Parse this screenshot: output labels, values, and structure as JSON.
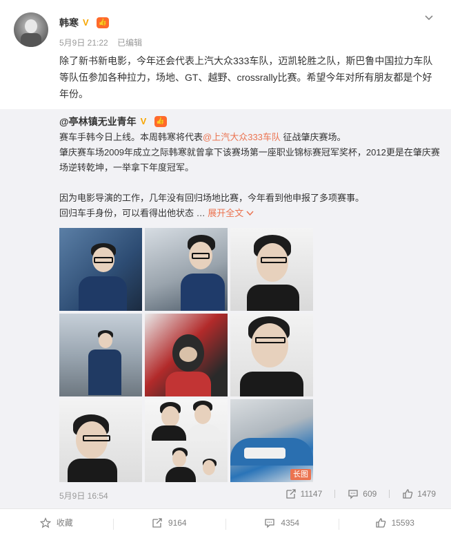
{
  "post": {
    "author": "韩寒",
    "verified_badge": "V",
    "fan_badge": "👍",
    "time": "5月9日 21:22",
    "edited": "已编辑",
    "text": "除了新书新电影，今年还会代表上汽大众333车队，迈凯轮胜之队，斯巴鲁中国拉力车队等队伍参加各种拉力，场地、GT、越野、crossrally比赛。希望今年对所有朋友都是个好年份。"
  },
  "repost": {
    "author": "@亭林镇无业青年",
    "verified_badge": "V",
    "fan_badge": "👍",
    "line1_pre": "赛车手韩今日上线。本周韩寒将代表",
    "line1_mention": "@上汽大众333车队",
    "line1_post": " 征战肇庆赛场。",
    "line2": "肇庆赛车场2009年成立之际韩寒就曾拿下该赛场第一座职业锦标赛冠军奖杯，2012更是在肇庆赛场逆转乾坤，一举拿下年度冠军。",
    "line3": "因为电影导演的工作，几年没有回归场地比赛，今年看到他申报了多项赛事。",
    "line4_pre": "回归车手身份，可以看得出他状态 … ",
    "expand": "展开全文",
    "long_image_tag": "长图",
    "time": "5月9日 16:54",
    "reposts": "11147",
    "comments": "609",
    "likes": "1479"
  },
  "bottom": {
    "favorite": "收藏",
    "repost": "9164",
    "comment": "4354",
    "like": "15593"
  },
  "colors": {
    "accent": "#eb7350",
    "repost_bg": "#f2f2f5",
    "meta_text": "#999999",
    "verified": "#f7a600"
  }
}
